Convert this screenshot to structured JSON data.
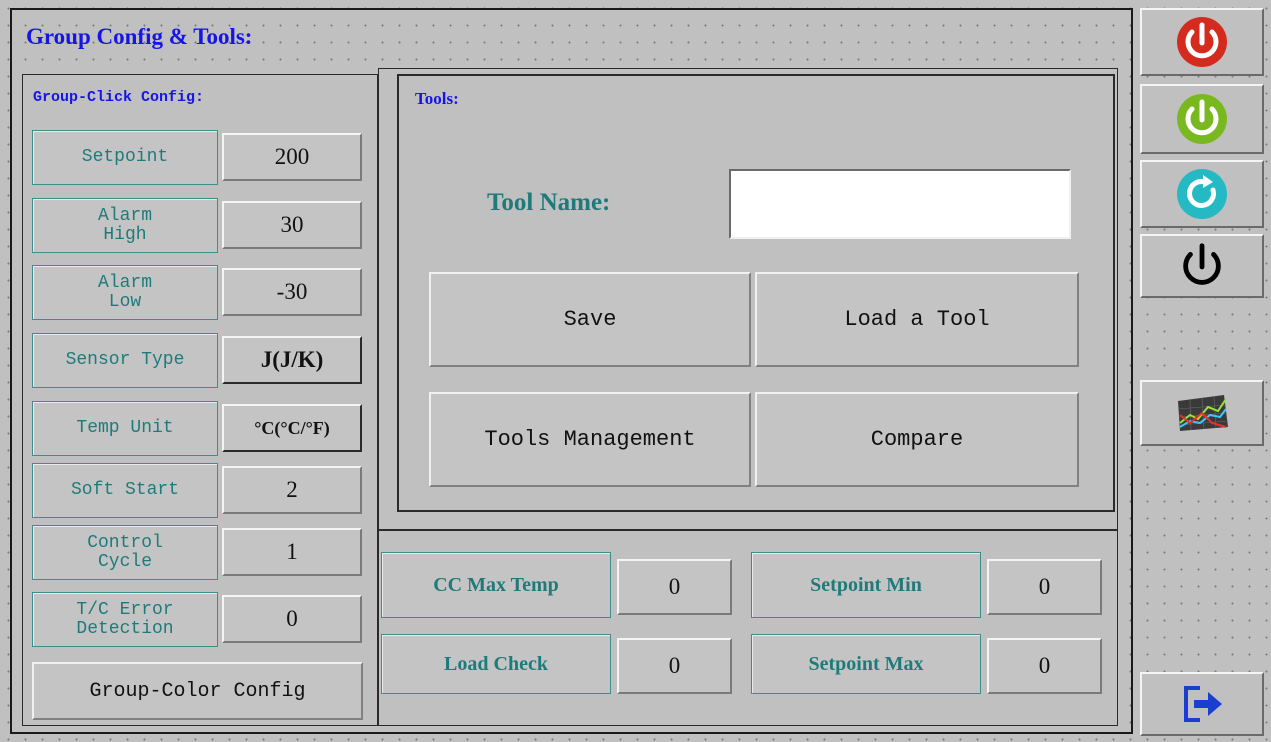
{
  "title": "Group Config & Tools:",
  "group_click": {
    "heading": "Group-Click Config:",
    "rows": [
      {
        "label": "Setpoint",
        "value": "200"
      },
      {
        "label": "Alarm\nHigh",
        "value": "30"
      },
      {
        "label": "Alarm\nLow",
        "value": "-30"
      },
      {
        "label": "Sensor Type",
        "value": "J(J/K)"
      },
      {
        "label": "Temp Unit",
        "value": "°C(°C/°F)"
      },
      {
        "label": "Soft Start",
        "value": "2"
      },
      {
        "label": "Control\nCycle",
        "value": "1"
      },
      {
        "label": "T/C Error\nDetection",
        "value": "0"
      }
    ],
    "color_config_label": "Group-Color Config"
  },
  "tools": {
    "heading": "Tools:",
    "tool_name_label": "Tool Name:",
    "tool_name_value": "",
    "save_label": "Save",
    "load_label": "Load a Tool",
    "manage_label": "Tools Management",
    "compare_label": "Compare"
  },
  "limits": {
    "cc_max_temp": {
      "label": "CC Max Temp",
      "value": "0"
    },
    "setpoint_min": {
      "label": "Setpoint Min",
      "value": "0"
    },
    "load_check": {
      "label": "Load Check",
      "value": "0"
    },
    "setpoint_max": {
      "label": "Setpoint Max",
      "value": "0"
    }
  },
  "sidebar": {
    "icons": [
      "power-red-icon",
      "power-green-icon",
      "refresh-teal-icon",
      "power-black-icon",
      "trend-chart-icon",
      "exit-icon"
    ]
  },
  "colors": {
    "title_blue": "#1515e8",
    "label_teal": "#1f7b7b",
    "power_red": "#d42b1e",
    "power_green": "#7ab820",
    "refresh_teal": "#25b9c4",
    "exit_blue": "#1a3fd0"
  }
}
